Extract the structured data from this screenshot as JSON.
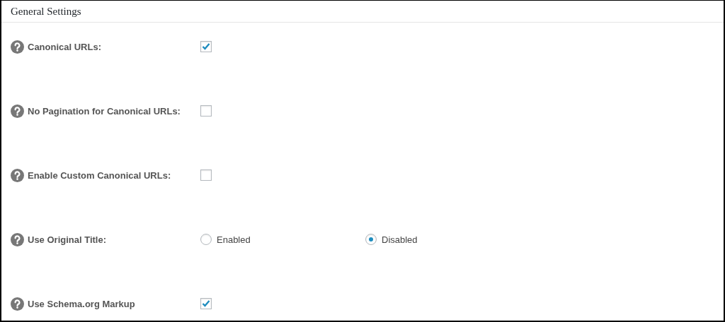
{
  "panel": {
    "title": "General Settings"
  },
  "settings": [
    {
      "kind": "checkbox",
      "label": "Canonical URLs:",
      "checked": true
    },
    {
      "kind": "checkbox",
      "label": "No Pagination for Canonical URLs:",
      "checked": false
    },
    {
      "kind": "checkbox",
      "label": "Enable Custom Canonical URLs:",
      "checked": false
    },
    {
      "kind": "radio",
      "label": "Use Original Title:",
      "options": [
        {
          "label": "Enabled",
          "selected": false
        },
        {
          "label": "Disabled",
          "selected": true
        }
      ]
    },
    {
      "kind": "checkbox",
      "label": "Use Schema.org Markup",
      "checked": true
    }
  ]
}
